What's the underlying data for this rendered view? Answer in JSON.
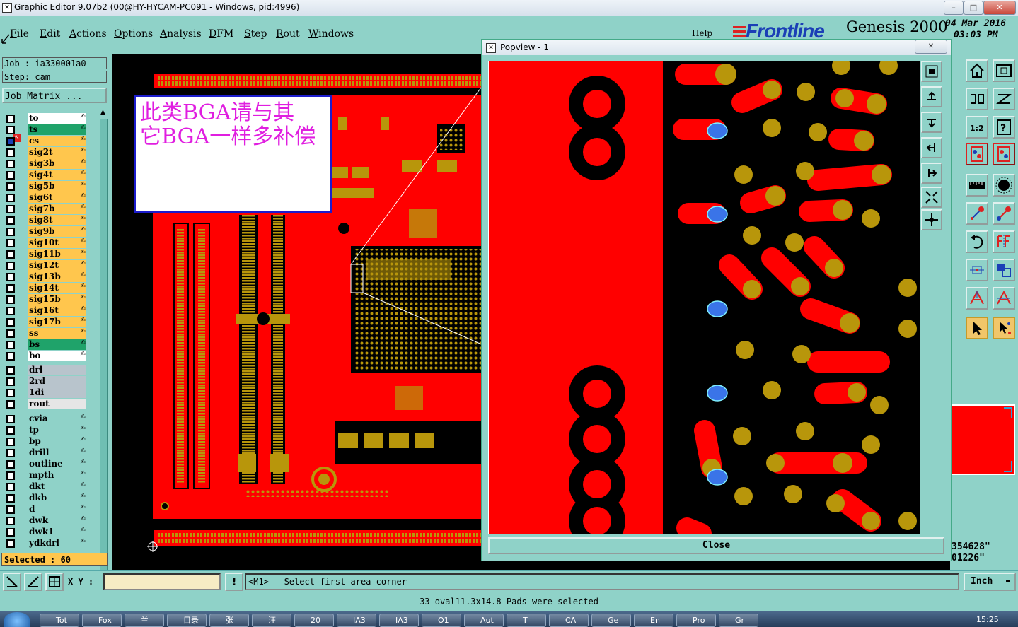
{
  "window": {
    "title": "Graphic Editor 9.07b2 (00@HY-HYCAM-PC091 - Windows, pid:4996)",
    "minimize": "–",
    "maximize": "□",
    "close": "✕"
  },
  "menu": [
    "File",
    "Edit",
    "Actions",
    "Options",
    "Analysis",
    "DFM",
    "Step",
    "Rout",
    "Windows"
  ],
  "help_label": "Help",
  "brand": {
    "logo": "Frontline",
    "product": "Genesis 2000",
    "date": "04 Mar 2016",
    "time": "03:03 PM"
  },
  "job": {
    "job_label": "Job : ia330001a0",
    "step_label": "Step: cam",
    "matrix_button": "Job Matrix ..."
  },
  "layers_signal": [
    {
      "name": "to",
      "color": "#ffffff"
    },
    {
      "name": "ts",
      "color": "#1fa36a"
    },
    {
      "name": "cs",
      "color": "#ffc64d",
      "active": true
    },
    {
      "name": "sig2t",
      "color": "#ffc64d"
    },
    {
      "name": "sig3b",
      "color": "#ffc64d"
    },
    {
      "name": "sig4t",
      "color": "#ffc64d"
    },
    {
      "name": "sig5b",
      "color": "#ffc64d"
    },
    {
      "name": "sig6t",
      "color": "#ffc64d"
    },
    {
      "name": "sig7b",
      "color": "#ffc64d"
    },
    {
      "name": "sig8t",
      "color": "#ffc64d"
    },
    {
      "name": "sig9b",
      "color": "#ffc64d"
    },
    {
      "name": "sig10t",
      "color": "#ffc64d"
    },
    {
      "name": "sig11b",
      "color": "#ffc64d"
    },
    {
      "name": "sig12t",
      "color": "#ffc64d"
    },
    {
      "name": "sig13b",
      "color": "#ffc64d"
    },
    {
      "name": "sig14t",
      "color": "#ffc64d"
    },
    {
      "name": "sig15b",
      "color": "#ffc64d"
    },
    {
      "name": "sig16t",
      "color": "#ffc64d"
    },
    {
      "name": "sig17b",
      "color": "#ffc64d"
    },
    {
      "name": "ss",
      "color": "#ffc64d"
    },
    {
      "name": "bs",
      "color": "#1fa36a"
    },
    {
      "name": "bo",
      "color": "#ffffff"
    }
  ],
  "layers_drill": [
    {
      "name": "drl",
      "color": "#b8c4cc"
    },
    {
      "name": "2rd",
      "color": "#b8c4cc"
    },
    {
      "name": "1di",
      "color": "#b8c4cc"
    },
    {
      "name": "rout",
      "color": "#e6e6e6"
    }
  ],
  "layers_misc": [
    {
      "name": "cvia",
      "color": "#8fd2c8"
    },
    {
      "name": "tp",
      "color": "#8fd2c8"
    },
    {
      "name": "bp",
      "color": "#8fd2c8"
    },
    {
      "name": "drill",
      "color": "#8fd2c8"
    },
    {
      "name": "outline",
      "color": "#8fd2c8"
    },
    {
      "name": "mpth",
      "color": "#8fd2c8"
    },
    {
      "name": "dkt",
      "color": "#8fd2c8"
    },
    {
      "name": "dkb",
      "color": "#8fd2c8"
    },
    {
      "name": "d",
      "color": "#8fd2c8"
    },
    {
      "name": "dwk",
      "color": "#8fd2c8"
    },
    {
      "name": "dwk1",
      "color": "#8fd2c8"
    },
    {
      "name": "ydkdrl",
      "color": "#8fd2c8"
    }
  ],
  "selected_label": "Selected : 60",
  "annotation": {
    "line1": "此类BGA请与其",
    "line2": "它BGA一样多补偿"
  },
  "popview": {
    "title": "Popview - 1",
    "close_button": "Close"
  },
  "coords": {
    "line1": "354628\"",
    "line2": "01226\""
  },
  "command": {
    "xy_label": "X Y :",
    "xy_value": "",
    "prompt": "<M1> - Select first area corner",
    "units": "Inch"
  },
  "status_message": "33 oval11.3x14.8 Pads were selected",
  "taskbar": {
    "items": [
      "Tot",
      "Fox",
      "兰",
      "目录",
      "张",
      "汪",
      "20",
      "IA3",
      "IA3",
      "O1",
      "Aut",
      "T",
      "CA",
      "Ge",
      "En",
      "Pro",
      "Gr"
    ],
    "clock": "15:25"
  },
  "colors": {
    "copper": "#ff0000",
    "pad": "#b8960b",
    "selected_pad": "#3a74e8",
    "teal": "#8fd2c8"
  }
}
